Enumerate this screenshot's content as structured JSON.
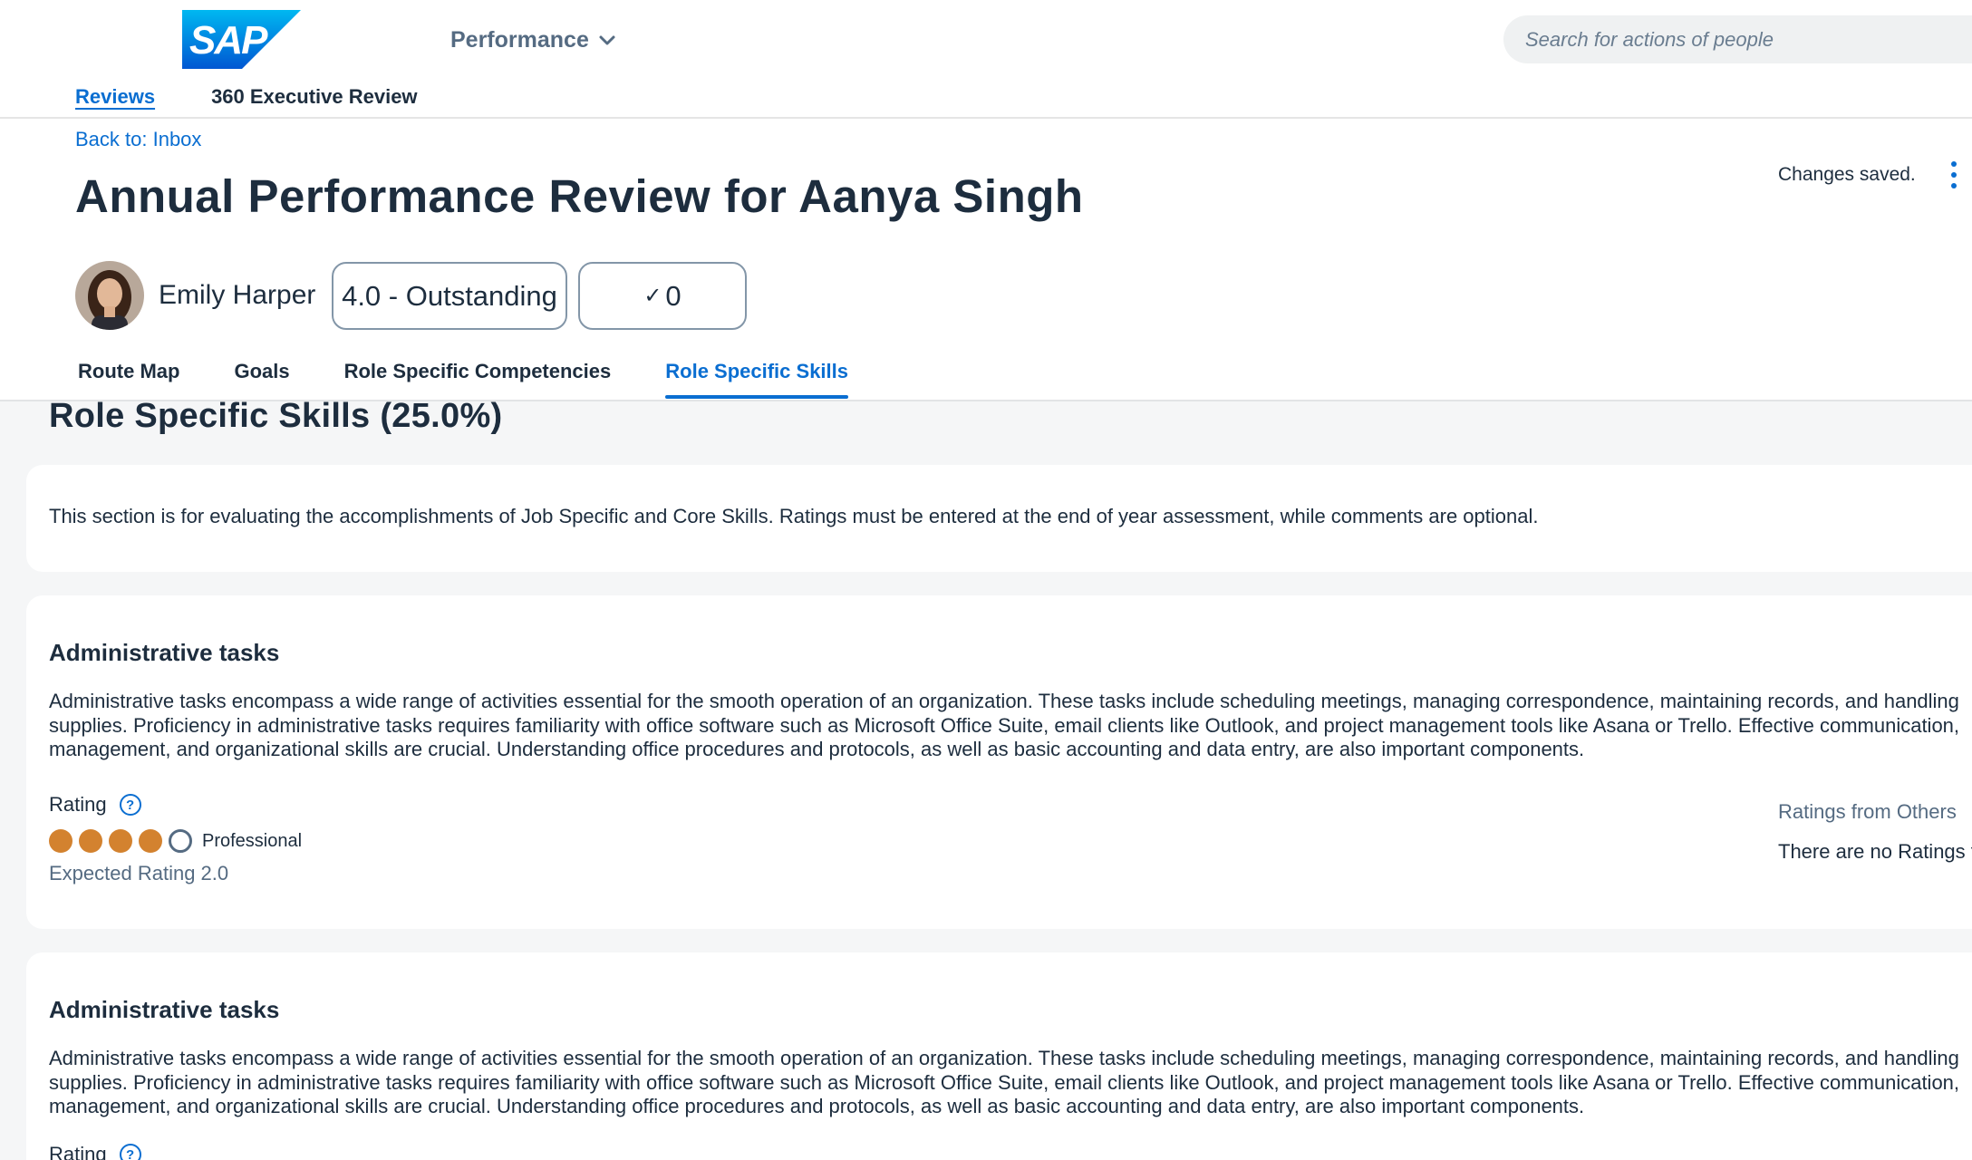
{
  "header": {
    "logo_text": "SAP",
    "menu_label": "Performance",
    "search_placeholder": "Search for actions of people",
    "subnav": {
      "reviews": "Reviews",
      "executive": "360 Executive Review"
    }
  },
  "titlebar": {
    "back_link": "Back to: Inbox",
    "title": "Annual Performance Review for Aanya Singh",
    "status": "Changes saved.",
    "person_name": "Emily Harper",
    "overall_rating": "4.0 - Outstanding",
    "check_icon": "✓",
    "check_count": "0",
    "tabs": [
      "Route Map",
      "Goals",
      "Role Specific Competencies",
      "Role Specific Skills"
    ],
    "active_tab": "Role Specific Skills"
  },
  "content": {
    "section_title": "Role Specific Skills (25.0%)",
    "intro": "This section is for evaluating the accomplishments of Job Specific and Core Skills. Ratings must be entered at the end of year assessment, while comments are optional.",
    "skills": [
      {
        "title": "Administrative tasks",
        "description": "Administrative tasks encompass a wide range of activities essential for the smooth operation of an organization. These tasks include scheduling meetings, managing correspondence, maintaining records, and handling supplies. Proficiency in administrative tasks requires familiarity with office software such as Microsoft Office Suite, email clients like Outlook, and project management tools like Asana or Trello. Effective communication, management, and organizational skills are crucial. Understanding office procedures and protocols, as well as basic accounting and data entry, are also important components.",
        "rating_label": "Rating",
        "rating_value": 4,
        "rating_max": 5,
        "rating_text": "Professional",
        "expected_rating": "Expected Rating 2.0",
        "others_title": "Ratings from Others",
        "others_text": "There are no Ratings from others"
      },
      {
        "title": "Administrative tasks",
        "description": "Administrative tasks encompass a wide range of activities essential for the smooth operation of an organization. These tasks include scheduling meetings, managing correspondence, maintaining records, and handling supplies. Proficiency in administrative tasks requires familiarity with office software such as Microsoft Office Suite, email clients like Outlook, and project management tools like Asana or Trello. Effective communication, management, and organizational skills are crucial. Understanding office procedures and protocols, as well as basic accounting and data entry, are also important components.",
        "rating_label": "Rating"
      }
    ]
  },
  "colors": {
    "accent": "#0a6ed1",
    "rating_fill": "#d3822f",
    "text": "#1d2d3e",
    "muted": "#556b82"
  },
  "icons": [
    "sap-logo",
    "chevron-down-icon",
    "kebab-menu-icon",
    "help-icon",
    "check-icon"
  ]
}
